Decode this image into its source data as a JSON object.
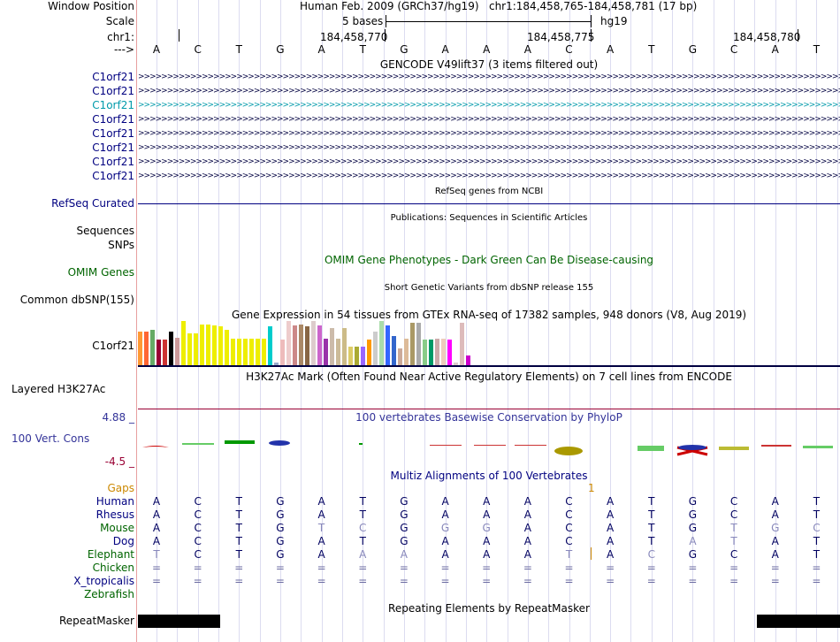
{
  "window_position": {
    "label": "Window Position",
    "assembly": "Human Feb. 2009 (GRCh37/hg19)",
    "range": "chr1:184,458,765-184,458,781 (17 bp)"
  },
  "scale": {
    "label": "Scale",
    "bases": "5 bases",
    "db": "hg19"
  },
  "chrom": {
    "label": "chr1:",
    "ticks": [
      "184,458,770",
      "184,458,775",
      "184,458,780"
    ],
    "strand_label": "--->",
    "sequence": [
      "A",
      "C",
      "T",
      "G",
      "A",
      "T",
      "G",
      "A",
      "A",
      "A",
      "C",
      "A",
      "T",
      "G",
      "C",
      "A",
      "T"
    ]
  },
  "gencode": {
    "title": "GENCODE V49lift37 (3 items filtered out)",
    "genes": [
      "C1orf21",
      "C1orf21",
      "C1orf21",
      "C1orf21",
      "C1orf21",
      "C1orf21",
      "C1orf21",
      "C1orf21"
    ],
    "selected_index": 2
  },
  "refseq": {
    "title": "RefSeq genes from NCBI",
    "label": "RefSeq Curated"
  },
  "publications": {
    "title": "Publications: Sequences in Scientific Articles",
    "label1": "Sequences",
    "label2": "SNPs"
  },
  "omim": {
    "label": "OMIM Genes",
    "title": "OMIM Gene Phenotypes - Dark Green Can Be Disease-causing"
  },
  "dbsnp": {
    "title": "Short Genetic Variants from dbSNP release 155",
    "label": "Common dbSNP(155)"
  },
  "gtex": {
    "title": "Gene Expression in 54 tissues from GTEx RNA-seq of 17382 samples, 948 donors (V8, Aug 2019)",
    "label": "C1orf21",
    "levels": [
      0.75,
      0.75,
      0.8,
      0.58,
      0.58,
      0.75,
      0.62,
      1.0,
      0.72,
      0.72,
      0.92,
      0.92,
      0.9,
      0.88,
      0.8,
      0.6,
      0.6,
      0.6,
      0.6,
      0.6,
      0.6,
      0.88,
      0.06,
      0.58,
      1.0,
      0.9,
      0.92,
      0.88,
      1.0,
      0.9,
      0.6,
      0.84,
      0.6,
      0.84,
      0.42,
      0.42,
      0.42,
      0.58,
      0.75,
      1.0,
      0.9,
      0.65,
      0.38,
      0.6,
      0.95,
      0.95,
      0.58,
      0.58,
      0.6,
      0.6,
      0.58,
      0.06,
      0.95,
      0.22
    ],
    "colors": [
      "#ff9933",
      "#ff6633",
      "#66aa66",
      "#990033",
      "#cc3333",
      "#000000",
      "#cc9999",
      "#eeee00",
      "#eeee00",
      "#eeee00",
      "#eeee00",
      "#eeee00",
      "#eeee00",
      "#eeee00",
      "#eeee00",
      "#eeee00",
      "#eeee00",
      "#eeee00",
      "#eeee00",
      "#eeee00",
      "#eeee00",
      "#00cccc",
      "#99aacc",
      "#eebbbb",
      "#eecccc",
      "#cc8888",
      "#aa8866",
      "#886644",
      "#ddcccc",
      "#cc66cc",
      "#9933aa",
      "#ccbbaa",
      "#ccbb99",
      "#ccbb88",
      "#ddcc66",
      "#aaaa33",
      "#9966ff",
      "#ff9900",
      "#cccccc",
      "#aaddaa",
      "#3366ff",
      "#3366cc",
      "#ccaa99",
      "#ddbb99",
      "#aa9966",
      "#aaaaaa",
      "#88cc88",
      "#009966",
      "#ccaaaa",
      "#eeccbb",
      "#ff00ff",
      "#ddcccc",
      "#ddbbbb",
      "#cc00cc"
    ]
  },
  "h3k27ac": {
    "label": "Layered H3K27Ac",
    "title": "H3K27Ac Mark (Often Found Near Active Regulatory Elements) on 7 cell lines from ENCODE"
  },
  "phylop": {
    "title": "100 vertebrates Basewise Conservation by PhyloP",
    "label": "100 Vert. Cons",
    "ymax": "4.88 _",
    "ymin": "-4.5 _"
  },
  "multiz": {
    "title": "Multiz Alignments of 100 Vertebrates",
    "gaps_label": "Gaps",
    "gap_marker": "1",
    "species": [
      {
        "name": "Human",
        "color": "#000080",
        "seq": [
          "A",
          "C",
          "T",
          "G",
          "A",
          "T",
          "G",
          "A",
          "A",
          "A",
          "C",
          "A",
          "T",
          "G",
          "C",
          "A",
          "T"
        ]
      },
      {
        "name": "Rhesus",
        "color": "#000080",
        "seq": [
          "A",
          "C",
          "T",
          "G",
          "A",
          "T",
          "G",
          "A",
          "A",
          "A",
          "C",
          "A",
          "T",
          "G",
          "C",
          "A",
          "T"
        ]
      },
      {
        "name": "Mouse",
        "color": "#006400",
        "seq": [
          "A",
          "C",
          "T",
          "G",
          "T",
          "C",
          "G",
          "G",
          "G",
          "A",
          "C",
          "A",
          "T",
          "G",
          "T",
          "G",
          "C"
        ]
      },
      {
        "name": "Dog",
        "color": "#000080",
        "seq": [
          "A",
          "C",
          "T",
          "G",
          "A",
          "T",
          "G",
          "A",
          "A",
          "A",
          "C",
          "A",
          "T",
          "A",
          "T",
          "A",
          "T"
        ]
      },
      {
        "name": "Elephant",
        "color": "#006400",
        "seq": [
          "T",
          "C",
          "T",
          "G",
          "A",
          "A",
          "A",
          "A",
          "A",
          "A",
          "T",
          "A",
          "C",
          "G",
          "C",
          "A",
          "T"
        ]
      },
      {
        "name": "Chicken",
        "color": "#006400",
        "seq": [
          "=",
          "=",
          "=",
          "=",
          "=",
          "=",
          "=",
          "=",
          "=",
          "=",
          "=",
          "=",
          "=",
          "=",
          "=",
          "=",
          "="
        ]
      },
      {
        "name": "X_tropicalis",
        "color": "#000080",
        "seq": [
          "=",
          "=",
          "=",
          "=",
          "=",
          "=",
          "=",
          "=",
          "=",
          "=",
          "=",
          "=",
          "=",
          "=",
          "=",
          "=",
          "="
        ]
      },
      {
        "name": "Zebrafish",
        "color": "#006400",
        "seq": []
      }
    ]
  },
  "repeatmasker": {
    "title": "Repeating Elements by RepeatMasker",
    "label": "RepeatMasker"
  }
}
